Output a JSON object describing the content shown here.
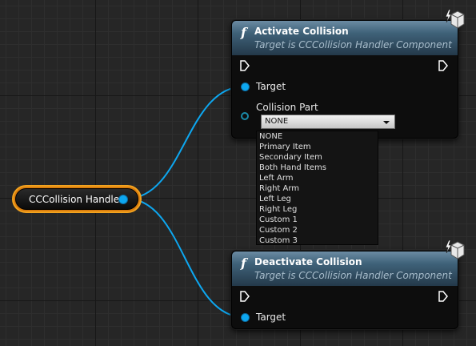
{
  "variable_node": {
    "label": "CCCollision Handler"
  },
  "activate_node": {
    "title": "Activate Collision",
    "subtitle": "Target is CCCollision Handler Component",
    "icon": "f",
    "target_label": "Target",
    "collision_part_label": "Collision Part",
    "collision_part_value": "NONE"
  },
  "dropdown": {
    "options": [
      "NONE",
      "Primary Item",
      "Secondary Item",
      "Both Hand Items",
      "Left Arm",
      "Right Arm",
      "Left Leg",
      "Right Leg",
      "Custom 1",
      "Custom 2",
      "Custom 3"
    ]
  },
  "deactivate_node": {
    "title": "Deactivate Collision",
    "subtitle": "Target is CCCollision Handler Component",
    "icon": "f",
    "target_label": "Target"
  },
  "colors": {
    "wire": "#0da7f0",
    "variable_border": "#f2a21e",
    "header": "#3f6279"
  }
}
